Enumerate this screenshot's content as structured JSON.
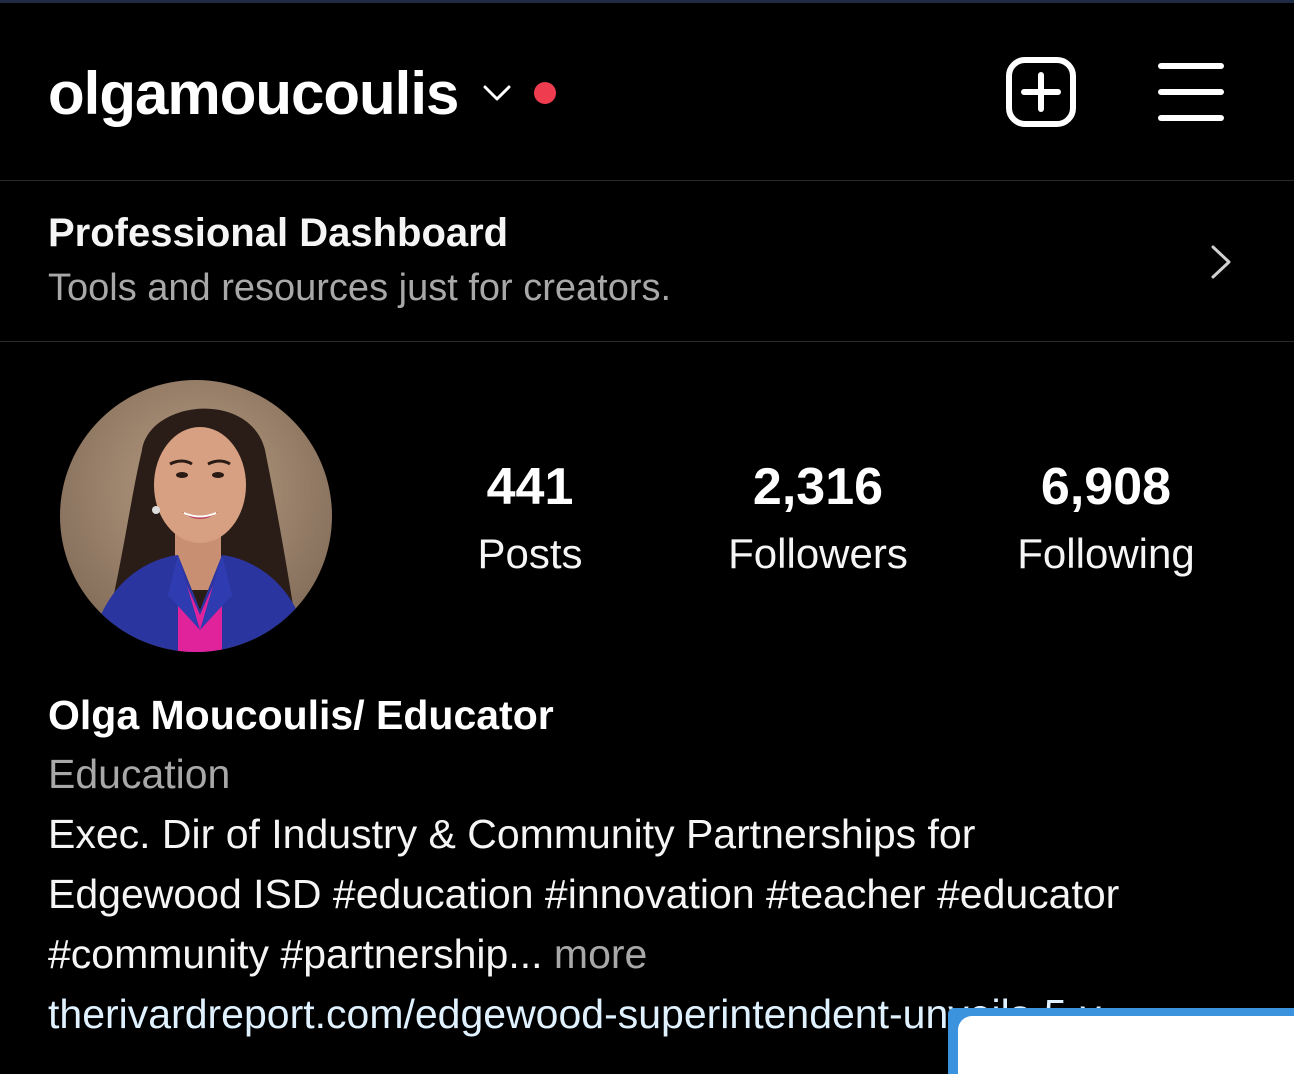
{
  "header": {
    "username": "olgamoucoulis",
    "live_dot_color": "#ef3d4f",
    "icons": [
      "chevron-down-icon",
      "new-post-icon",
      "hamburger-menu-icon"
    ]
  },
  "dashboard": {
    "title": "Professional Dashboard",
    "subtitle": "Tools and resources just for creators."
  },
  "stats": [
    {
      "value": "441",
      "label": "Posts"
    },
    {
      "value": "2,316",
      "label": "Followers"
    },
    {
      "value": "6,908",
      "label": "Following"
    }
  ],
  "bio": {
    "name": "Olga Moucoulis/ Educator",
    "category": "Education",
    "line1": "Exec. Dir of Industry & Community Partnerships for",
    "line2": "Edgewood ISD #education #innovation #teacher #educator",
    "line3": "#community #partnership...",
    "more": "more",
    "link": "therivardreport.com/edgewood-superintendent-unveils-5-y"
  }
}
